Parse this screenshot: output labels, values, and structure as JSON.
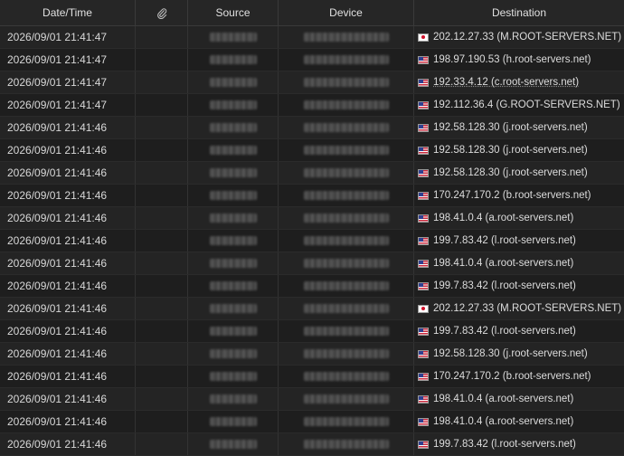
{
  "columns": {
    "datetime": "Date/Time",
    "attachment_icon": "paperclip-icon",
    "source": "Source",
    "device": "Device",
    "destination": "Destination"
  },
  "rows": [
    {
      "datetime": "2026/09/01 21:41:47",
      "flag": "jp",
      "destination": "202.12.27.33 (M.ROOT-SERVERS.NET)"
    },
    {
      "datetime": "2026/09/01 21:41:47",
      "flag": "us",
      "destination": "198.97.190.53 (h.root-servers.net)"
    },
    {
      "datetime": "2026/09/01 21:41:47",
      "flag": "us",
      "destination": "192.33.4.12 (c.root-servers.net)",
      "hovered": true
    },
    {
      "datetime": "2026/09/01 21:41:47",
      "flag": "us",
      "destination": "192.112.36.4 (G.ROOT-SERVERS.NET)"
    },
    {
      "datetime": "2026/09/01 21:41:46",
      "flag": "us",
      "destination": "192.58.128.30 (j.root-servers.net)"
    },
    {
      "datetime": "2026/09/01 21:41:46",
      "flag": "us",
      "destination": "192.58.128.30 (j.root-servers.net)"
    },
    {
      "datetime": "2026/09/01 21:41:46",
      "flag": "us",
      "destination": "192.58.128.30 (j.root-servers.net)"
    },
    {
      "datetime": "2026/09/01 21:41:46",
      "flag": "us",
      "destination": "170.247.170.2 (b.root-servers.net)"
    },
    {
      "datetime": "2026/09/01 21:41:46",
      "flag": "us",
      "destination": "198.41.0.4 (a.root-servers.net)"
    },
    {
      "datetime": "2026/09/01 21:41:46",
      "flag": "us",
      "destination": "199.7.83.42 (l.root-servers.net)"
    },
    {
      "datetime": "2026/09/01 21:41:46",
      "flag": "us",
      "destination": "198.41.0.4 (a.root-servers.net)"
    },
    {
      "datetime": "2026/09/01 21:41:46",
      "flag": "us",
      "destination": "199.7.83.42 (l.root-servers.net)"
    },
    {
      "datetime": "2026/09/01 21:41:46",
      "flag": "jp",
      "destination": "202.12.27.33 (M.ROOT-SERVERS.NET)"
    },
    {
      "datetime": "2026/09/01 21:41:46",
      "flag": "us",
      "destination": "199.7.83.42 (l.root-servers.net)"
    },
    {
      "datetime": "2026/09/01 21:41:46",
      "flag": "us",
      "destination": "192.58.128.30 (j.root-servers.net)"
    },
    {
      "datetime": "2026/09/01 21:41:46",
      "flag": "us",
      "destination": "170.247.170.2 (b.root-servers.net)"
    },
    {
      "datetime": "2026/09/01 21:41:46",
      "flag": "us",
      "destination": "198.41.0.4 (a.root-servers.net)"
    },
    {
      "datetime": "2026/09/01 21:41:46",
      "flag": "us",
      "destination": "198.41.0.4 (a.root-servers.net)"
    },
    {
      "datetime": "2026/09/01 21:41:46",
      "flag": "us",
      "destination": "199.7.83.42 (l.root-servers.net)"
    }
  ]
}
